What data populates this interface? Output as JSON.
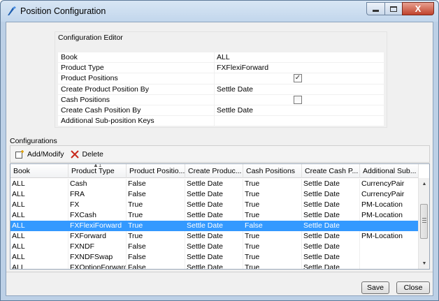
{
  "window": {
    "title": "Position Configuration",
    "close_glyph": "X"
  },
  "editor": {
    "title": "Configuration Editor",
    "rows": [
      {
        "name": "Book",
        "value": "ALL"
      },
      {
        "name": "Product Type",
        "value": "FXFlexiForward"
      },
      {
        "name": "Product Positions",
        "value": "",
        "checked": true
      },
      {
        "name": "Create Product Position By",
        "value": "Settle Date"
      },
      {
        "name": "Cash Positions",
        "value": "",
        "checked": false
      },
      {
        "name": "Create Cash Position By",
        "value": "Settle Date"
      },
      {
        "name": "Additional Sub-position Keys",
        "value": ""
      }
    ]
  },
  "configurations": {
    "label": "Configurations",
    "toolbar": {
      "add_modify_label": "Add/Modify",
      "delete_label": "Delete"
    },
    "sort_index": "1",
    "columns": [
      "Book",
      "Product Type",
      "Product Positio...",
      "Create Produc...",
      "Cash Positions",
      "Create Cash P...",
      "Additional Sub..."
    ],
    "rows": [
      [
        "ALL",
        "Cash",
        "False",
        "Settle Date",
        "True",
        "Settle Date",
        "CurrencyPair"
      ],
      [
        "ALL",
        "FRA",
        "False",
        "Settle Date",
        "True",
        "Settle Date",
        "CurrencyPair"
      ],
      [
        "ALL",
        "FX",
        "True",
        "Settle Date",
        "True",
        "Settle Date",
        "PM-Location"
      ],
      [
        "ALL",
        "FXCash",
        "True",
        "Settle Date",
        "True",
        "Settle Date",
        "PM-Location"
      ],
      [
        "ALL",
        "FXFlexiForward",
        "True",
        "Settle Date",
        "False",
        "Settle Date",
        ""
      ],
      [
        "ALL",
        "FXForward",
        "True",
        "Settle Date",
        "True",
        "Settle Date",
        "PM-Location"
      ],
      [
        "ALL",
        "FXNDF",
        "False",
        "Settle Date",
        "True",
        "Settle Date",
        ""
      ],
      [
        "ALL",
        "FXNDFSwap",
        "False",
        "Settle Date",
        "True",
        "Settle Date",
        ""
      ],
      [
        "ALL",
        "FXOptionForward",
        "False",
        "Settle Date",
        "True",
        "Settle Date",
        ""
      ]
    ],
    "selected_row": 4
  },
  "footer": {
    "save_label": "Save",
    "close_label": "Close"
  }
}
